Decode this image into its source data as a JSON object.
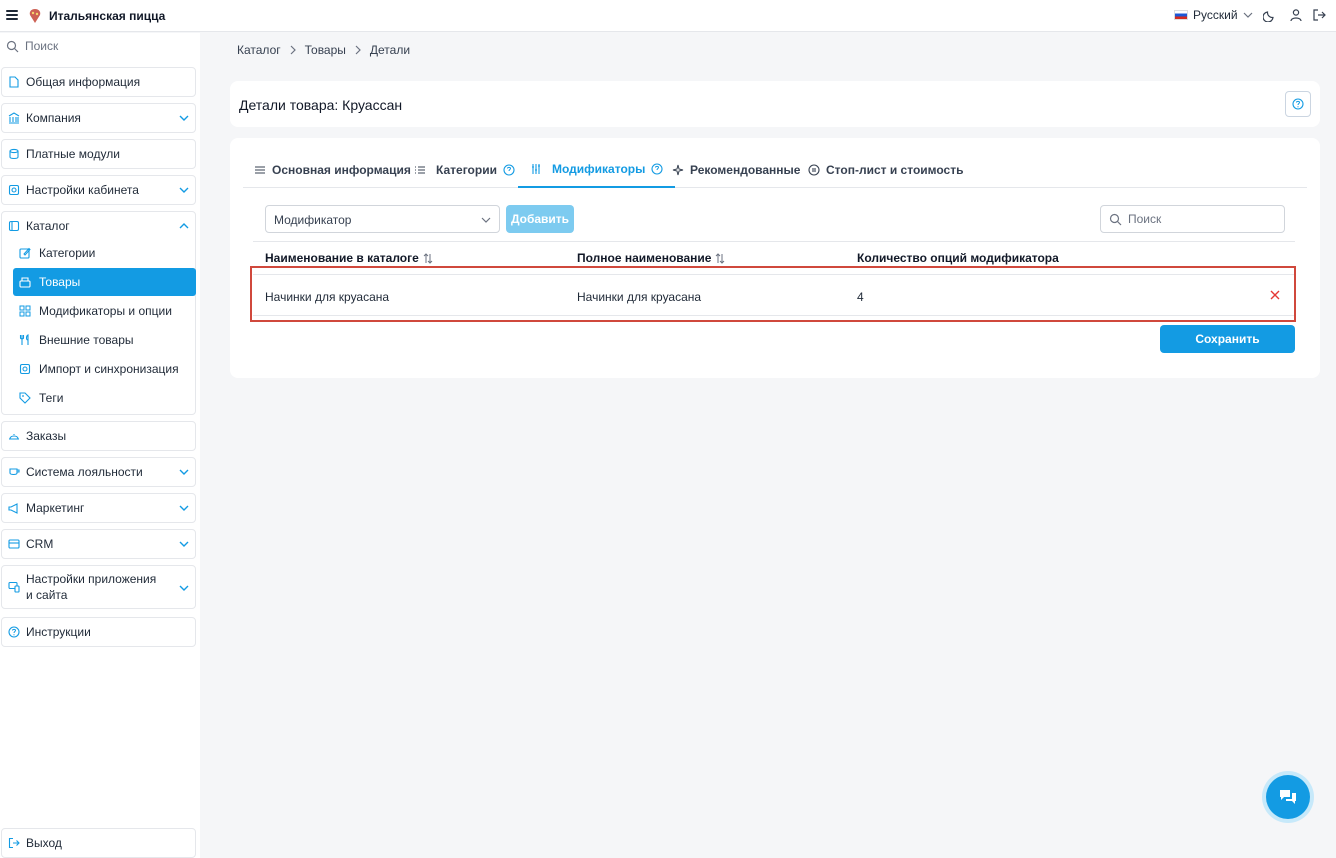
{
  "topbar": {
    "app_title": "Итальянская пицца",
    "language": "Русский"
  },
  "sidebar": {
    "search_placeholder": "Поиск",
    "items": [
      {
        "label": "Общая информация"
      },
      {
        "label": "Компания"
      },
      {
        "label": "Платные модули"
      },
      {
        "label": "Настройки кабинета"
      }
    ],
    "catalog": {
      "label": "Каталог",
      "children": [
        {
          "label": "Категории"
        },
        {
          "label": "Товары"
        },
        {
          "label": "Модификаторы и опции"
        },
        {
          "label": "Внешние товары"
        },
        {
          "label": "Импорт и синхронизация"
        },
        {
          "label": "Теги"
        }
      ]
    },
    "items_after": [
      {
        "label": "Заказы"
      },
      {
        "label": "Система лояльности"
      },
      {
        "label": "Маркетинг"
      },
      {
        "label": "CRM"
      },
      {
        "label": "Настройки приложения и сайта"
      },
      {
        "label": "Инструкции"
      }
    ],
    "logout": "Выход"
  },
  "breadcrumb": [
    "Каталог",
    "Товары",
    "Детали"
  ],
  "page_title": "Детали товара: Круассан",
  "tabs": [
    {
      "label": "Основная информация"
    },
    {
      "label": "Категории"
    },
    {
      "label": "Модификаторы"
    },
    {
      "label": "Рекомендованные"
    },
    {
      "label": "Стоп-лист и стоимость"
    }
  ],
  "toolbar": {
    "select_value": "Модификатор",
    "add_label": "Добавить",
    "search_placeholder": "Поиск"
  },
  "table": {
    "columns": [
      "Наименование в каталоге",
      "Полное наименование",
      "Количество опций модификатора"
    ],
    "rows": [
      {
        "catalog_name": "Начинки для круасана",
        "full_name": "Начинки для круасана",
        "options_count": "4"
      }
    ]
  },
  "save_label": "Сохранить",
  "colors": {
    "accent": "#139be3",
    "highlight": "#d0483c",
    "delete": "#e53935"
  }
}
